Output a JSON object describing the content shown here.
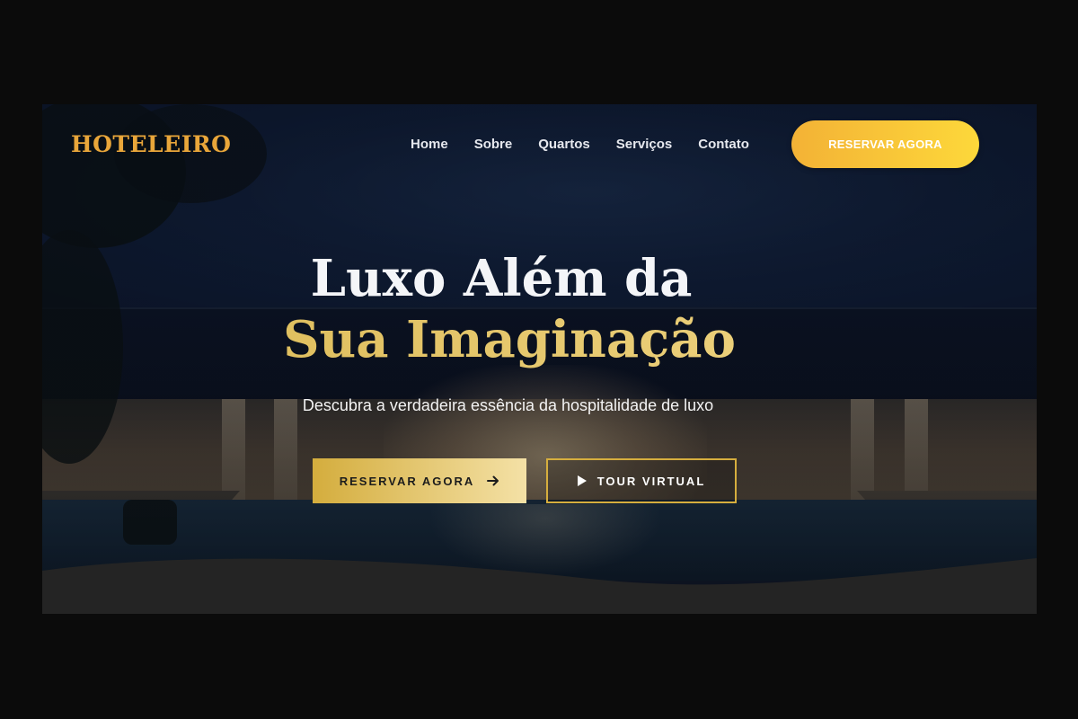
{
  "brand": {
    "logo_text": "HOTELEIRO",
    "accent_color": "#e9a63a",
    "gold_gradient": [
      "#d4ad3d",
      "#f4e1a6"
    ]
  },
  "nav": {
    "items": [
      {
        "label": "Home"
      },
      {
        "label": "Sobre"
      },
      {
        "label": "Quartos"
      },
      {
        "label": "Serviços"
      },
      {
        "label": "Contato"
      }
    ],
    "cta_label": "RESERVAR AGORA",
    "cta_color": "#fdd83a"
  },
  "hero": {
    "title_line1": "Luxo Além da",
    "title_line2": "Sua Imaginação",
    "subtitle": "Descubra a verdadeira essência da hospitalidade de luxo",
    "primary_button": {
      "label": "RESERVAR AGORA",
      "icon": "arrow-right-icon"
    },
    "secondary_button": {
      "label": "TOUR VIRTUAL",
      "icon": "play-icon"
    }
  }
}
